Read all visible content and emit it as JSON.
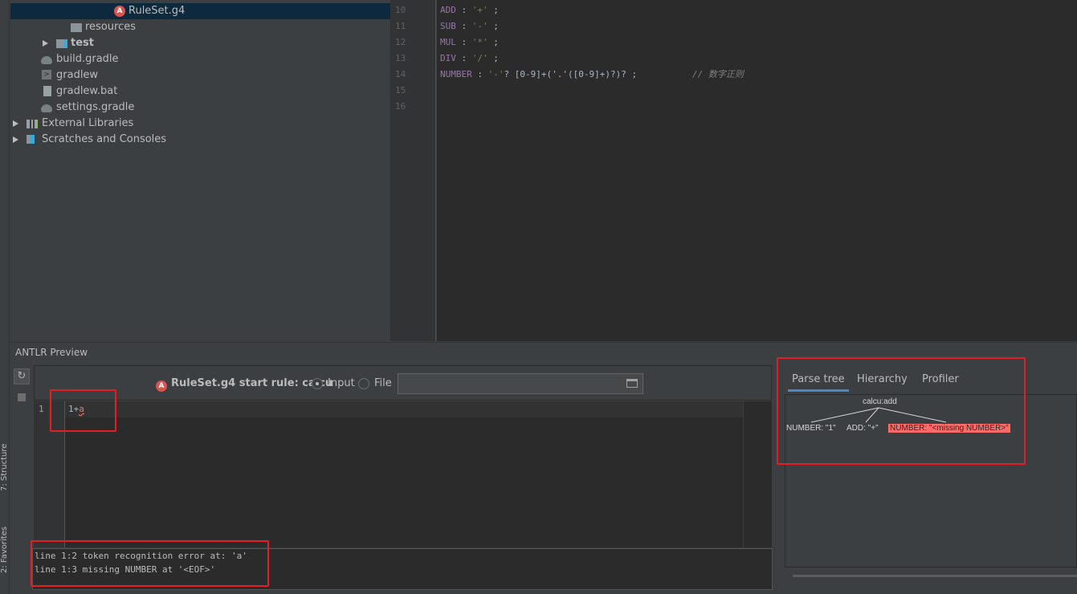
{
  "project_tree": {
    "items": [
      {
        "label": "RuleSet.g4",
        "icon": "antlr-icon"
      },
      {
        "label": "resources",
        "icon": "folder-icon"
      },
      {
        "label": "test",
        "icon": "folder-icon"
      },
      {
        "label": "build.gradle",
        "icon": "gradle-icon"
      },
      {
        "label": "gradlew",
        "icon": "script-icon"
      },
      {
        "label": "gradlew.bat",
        "icon": "file-icon"
      },
      {
        "label": "settings.gradle",
        "icon": "gradle-icon"
      },
      {
        "label": "External Libraries",
        "icon": "libraries-icon"
      },
      {
        "label": "Scratches and Consoles",
        "icon": "scratches-icon"
      }
    ]
  },
  "side_strip": {
    "structure_label": "7: Structure",
    "favorites_label": "2: Favorites"
  },
  "editor": {
    "line_numbers": [
      "10",
      "11",
      "12",
      "13",
      "14",
      "15",
      "16"
    ],
    "lines": [
      {
        "name": "ADD",
        "rest": " : ",
        "str": "'+'",
        "tail": " ;",
        "comment": ""
      },
      {
        "name": "SUB",
        "rest": " : ",
        "str": "'-'",
        "tail": " ;",
        "comment": ""
      },
      {
        "name": "MUL",
        "rest": " : ",
        "str": "'*'",
        "tail": " ;",
        "comment": ""
      },
      {
        "name": "DIV",
        "rest": " : ",
        "str": "'/'",
        "tail": " ;",
        "comment": ""
      },
      {
        "name": "NUMBER",
        "rest": " : ",
        "str": "'-'",
        "tail": "? [0-9]+('.'([0-9]+)?)? ;",
        "comment": "// 数字正则"
      }
    ]
  },
  "preview": {
    "title": "ANTLR Preview",
    "start_rule": "RuleSet.g4 start rule: calcu",
    "input_radio": "Input",
    "file_radio": "File",
    "input_line_number": "1",
    "input_text_ok": "1+",
    "input_text_err": "a",
    "console": [
      "line 1:2 token recognition error at: 'a'",
      "line 1:3 missing NUMBER at '<EOF>'"
    ]
  },
  "tree_panel": {
    "tabs": [
      "Parse tree",
      "Hierarchy",
      "Profiler"
    ],
    "active_tab": "Parse tree",
    "root": "calcu:add",
    "children": [
      "NUMBER: \"1\"",
      "ADD: \"+\"",
      "NUMBER: \"<missing NUMBER>\""
    ]
  },
  "colors": {
    "selection": "#0d293e",
    "error": "#ff6b68",
    "annotation": "#e51e25",
    "tab_underline": "#4a88c7"
  }
}
